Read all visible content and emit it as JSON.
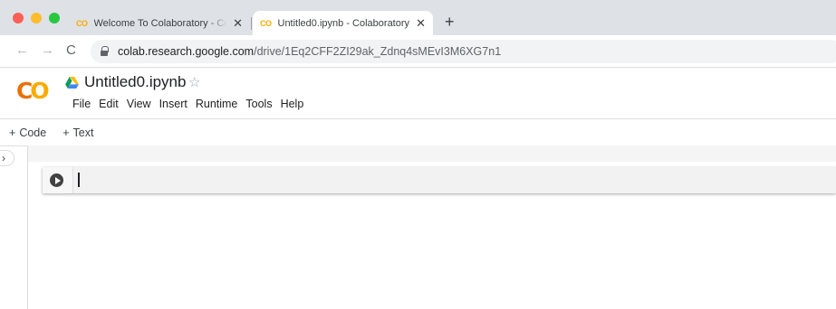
{
  "browser": {
    "traffic_colors": [
      "#fe5f57",
      "#febc2e",
      "#28c840"
    ],
    "tabs": [
      {
        "icon": "CO",
        "title": "Welcome To Colaboratory - Cola",
        "close": "✕",
        "active": false
      },
      {
        "icon": "CO",
        "title": "Untitled0.ipynb - Colaboratory",
        "close": "✕",
        "active": true
      }
    ],
    "new_tab": "+",
    "nav": {
      "back": "←",
      "forward": "→",
      "reload": "C"
    },
    "url": {
      "host": "colab.research.google.com",
      "path": "/drive/1Eq2CFF2ZI29ak_Zdnq4sMEvI3M6XG7n1"
    }
  },
  "colab": {
    "logo": {
      "part1": "C",
      "part2": "O"
    },
    "notebook_title": "Untitled0.ipynb",
    "star": "☆",
    "menu": [
      "File",
      "Edit",
      "View",
      "Insert",
      "Runtime",
      "Tools",
      "Help"
    ],
    "toolbar": {
      "code_label": "Code",
      "text_label": "Text",
      "plus": "+"
    },
    "sidebar_toggle": "›",
    "accent_orange": "#f9ab00",
    "accent_dark_orange": "#e8710a"
  }
}
